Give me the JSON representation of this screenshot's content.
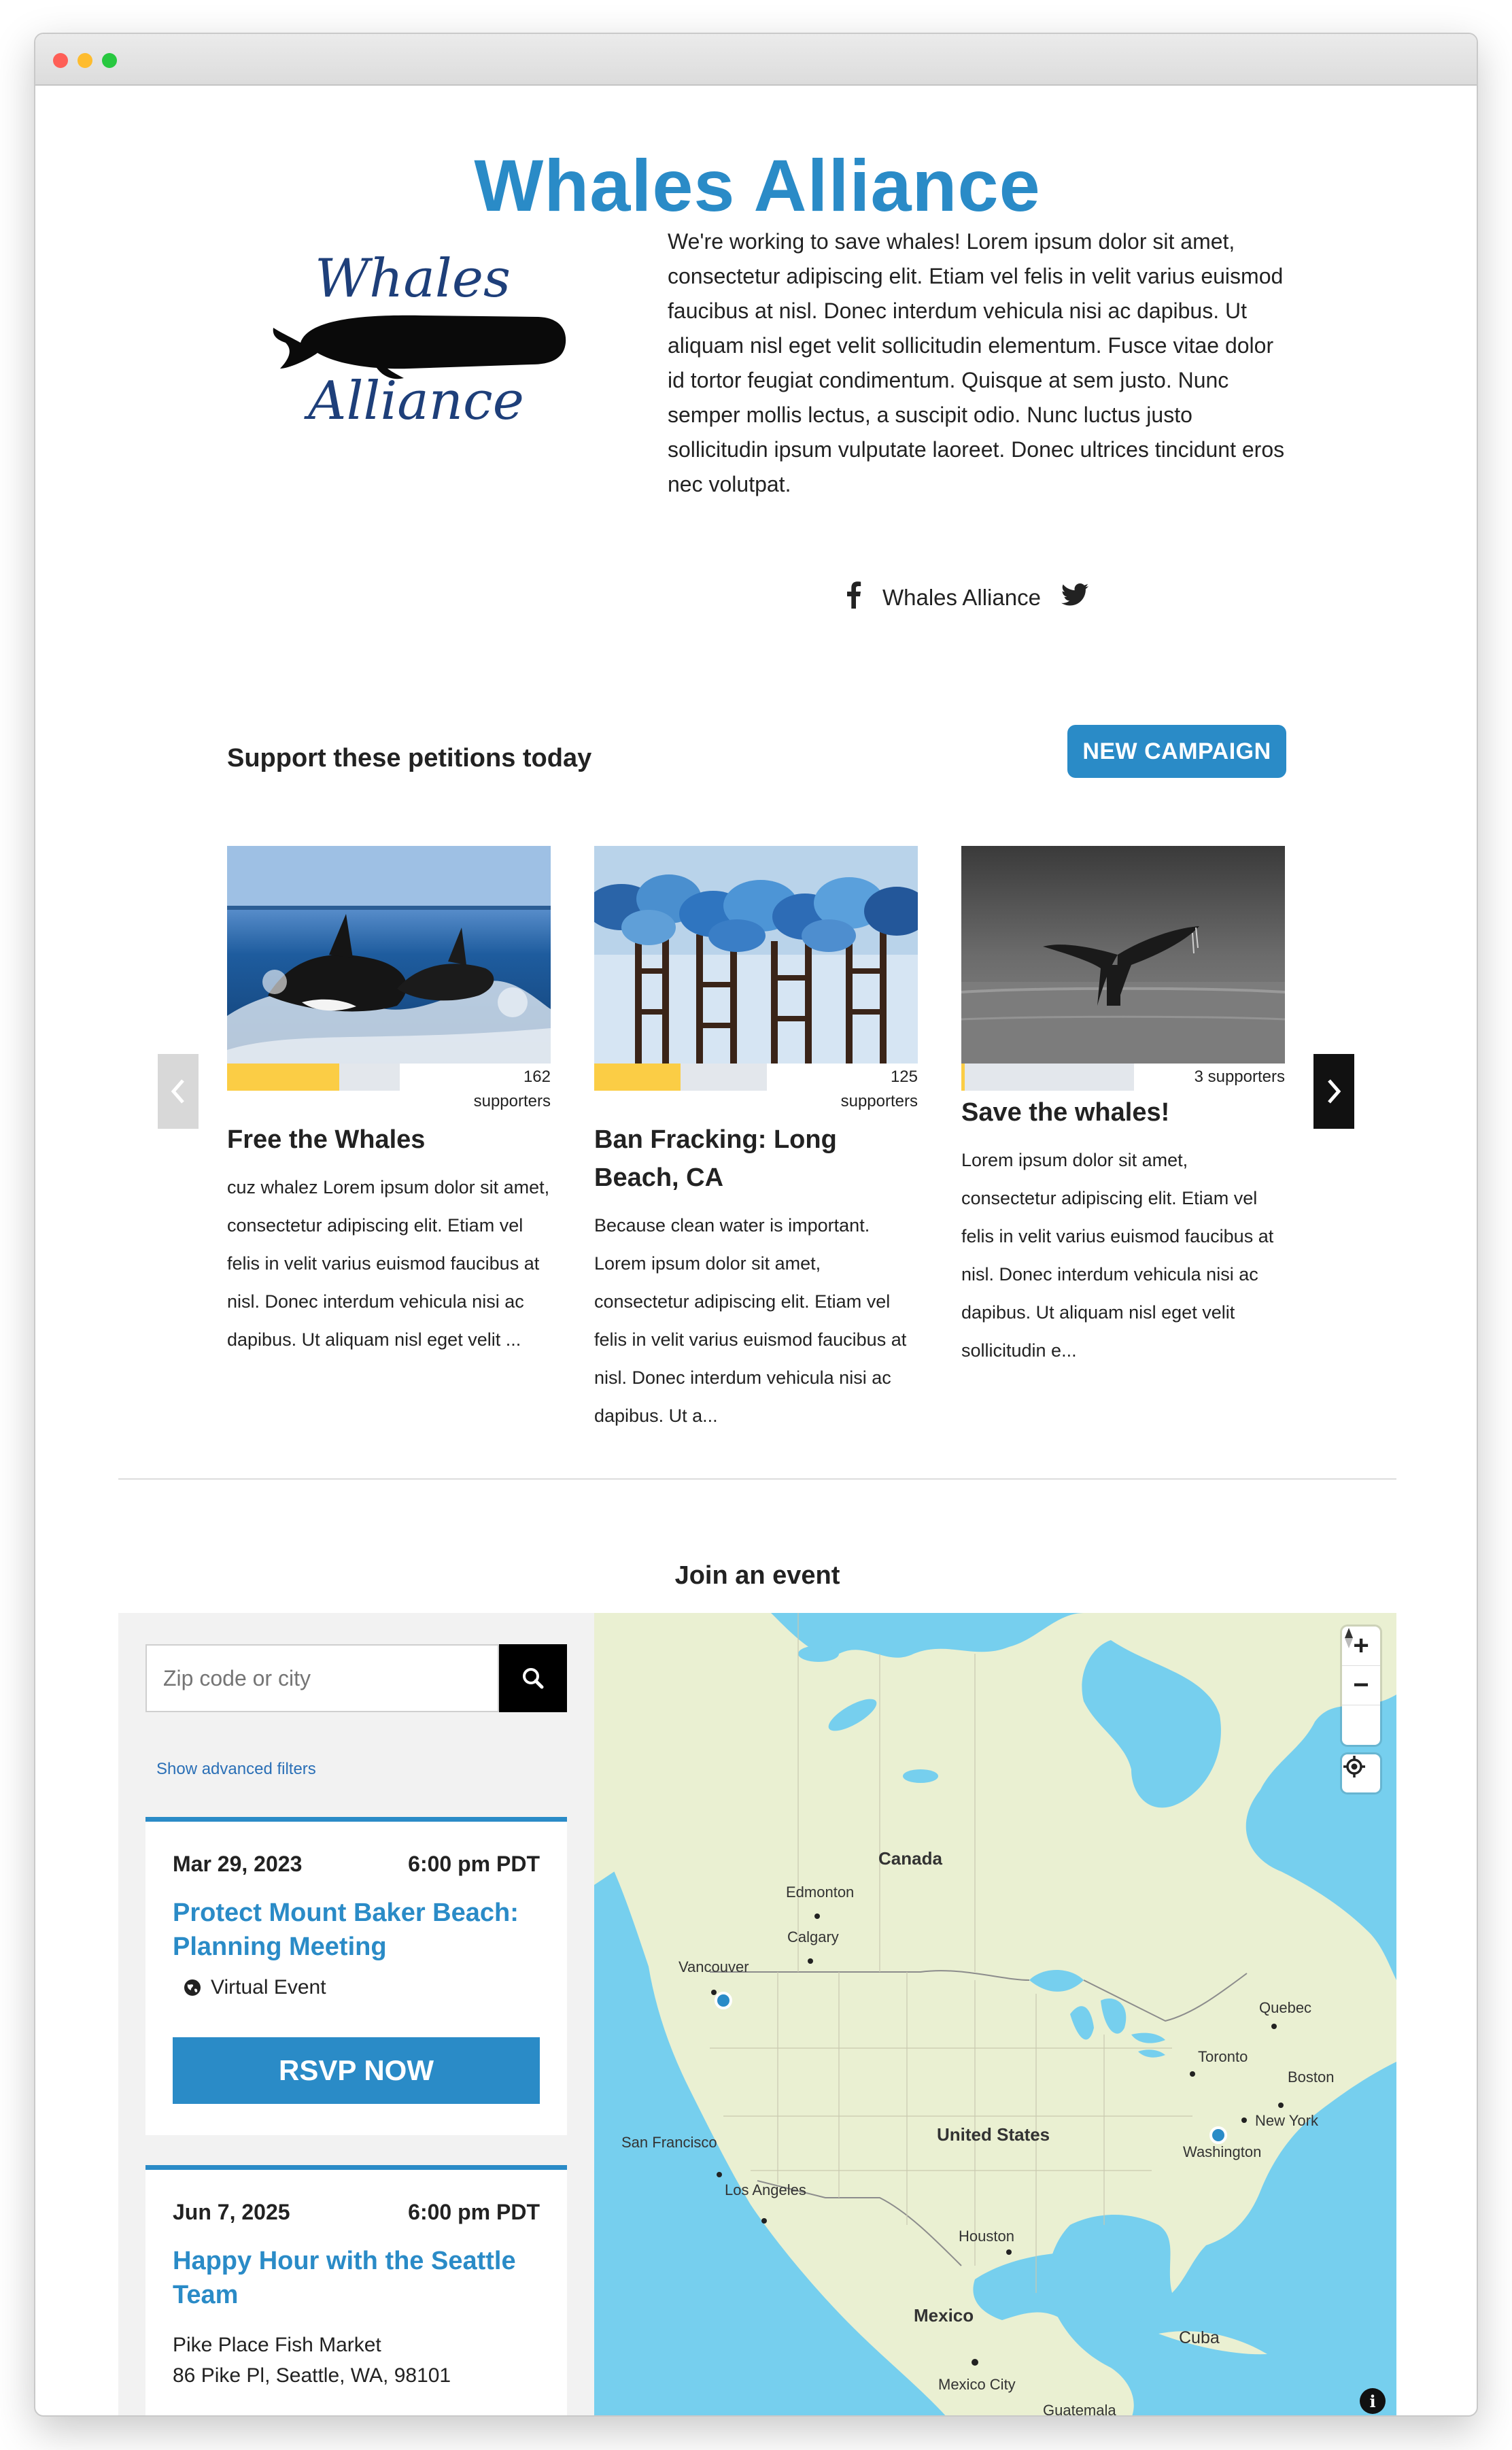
{
  "org": {
    "title": "Whales Alliance",
    "logo_text_top": "Whales",
    "logo_text_bottom": "Alliance",
    "intro": "We're working to save whales! Lorem ipsum dolor sit amet, consectetur adipiscing elit. Etiam vel felis in velit varius euismod faucibus at nisl. Donec interdum vehicula nisi ac dapibus. Ut aliquam nisl eget velit sollicitudin elementum. Fusce vitae dolor id tortor feugiat condimentum. Quisque at sem justo. Nunc semper mollis lectus, a suscipit odio. Nunc luctus justo sollicitudin ipsum vulputate laoreet. Donec ultrices tincidunt eros nec volutpat.",
    "social_name": "Whales Alliance"
  },
  "petitions": {
    "heading": "Support these petitions today",
    "new_campaign_label": "NEW CAMPAIGN",
    "items": [
      {
        "title": "Free the Whales",
        "count": "162",
        "count_suffix": "supporters",
        "progress": 0.65,
        "description": "cuz whalez Lorem ipsum dolor sit amet, consectetur adipiscing elit. Etiam vel felis in velit varius euismod faucibus at nisl. Donec interdum vehicula nisi ac dapibus. Ut aliquam nisl eget velit ..."
      },
      {
        "title": "Ban Fracking: Long Beach, CA",
        "count": "125",
        "count_suffix": "supporters",
        "progress": 0.5,
        "description": "Because clean water is important. Lorem ipsum dolor sit amet, consectetur adipiscing elit. Etiam vel felis in velit varius euismod faucibus at nisl. Donec interdum vehicula nisi ac dapibus. Ut a..."
      },
      {
        "title": "Save the whales!",
        "count": "3 supporters",
        "count_suffix": "",
        "progress": 0.02,
        "description": "Lorem ipsum dolor sit amet, consectetur adipiscing elit. Etiam vel felis in velit varius euismod faucibus at nisl. Donec interdum vehicula nisi ac dapibus. Ut aliquam nisl eget velit sollicitudin e..."
      }
    ]
  },
  "events": {
    "heading": "Join an event",
    "search_placeholder": "Zip code or city",
    "advanced_filters_label": "Show advanced filters",
    "rsvp_label": "RSVP NOW",
    "items": [
      {
        "date": "Mar 29, 2023",
        "time": "6:00 pm PDT",
        "title": "Protect Mount Baker Beach: Planning Meeting",
        "venue": "Virtual Event"
      },
      {
        "date": "Jun 7, 2025",
        "time": "6:00 pm PDT",
        "title": "Happy Hour with the Seattle Team",
        "address_line1": "Pike Place Fish Market",
        "address_line2": "86 Pike Pl, Seattle, WA, 98101"
      }
    ]
  },
  "map": {
    "zoom_in": "+",
    "zoom_out": "−",
    "info": "i",
    "labels": {
      "canada": "Canada",
      "united_states": "United States",
      "mexico": "Mexico",
      "edmonton": "Edmonton",
      "calgary": "Calgary",
      "vancouver": "Vancouver",
      "san_francisco": "San Francisco",
      "los_angeles": "Los Angeles",
      "houston": "Houston",
      "toronto": "Toronto",
      "quebec": "Quebec",
      "boston": "Boston",
      "new_york": "New York",
      "washington": "Washington",
      "cuba": "Cuba",
      "mexico_city": "Mexico City",
      "guatemala": "Guatemala"
    }
  },
  "colors": {
    "brand": "#2a8bc7",
    "progress_fill": "#fbcd45",
    "progress_track": "#e3e7ec",
    "water": "#76cfee",
    "land": "#eaf0d2"
  },
  "icons": [
    "facebook-icon",
    "twitter-icon",
    "chevron-left-icon",
    "chevron-right-icon",
    "search-icon",
    "globe-icon",
    "zoom-in-icon",
    "zoom-out-icon",
    "compass-icon",
    "locate-icon",
    "info-icon"
  ]
}
